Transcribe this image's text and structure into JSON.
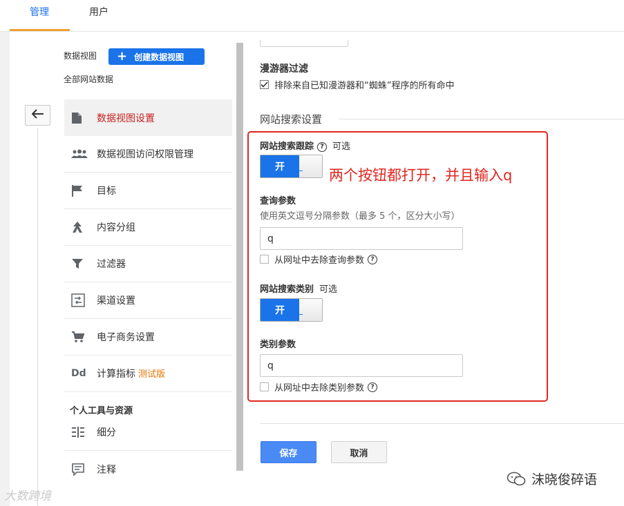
{
  "tabs": [
    {
      "label": "管理",
      "active": true
    },
    {
      "label": "用户",
      "active": false
    }
  ],
  "sidebar": {
    "view_label": "数据视图",
    "create_view_label": "创建数据视图",
    "all_data_label": "全部网站数据",
    "items": [
      {
        "label": "数据视图设置",
        "icon": "document-icon",
        "active": true
      },
      {
        "label": "数据视图访问权限管理",
        "icon": "users-icon"
      },
      {
        "label": "目标",
        "icon": "flag-icon"
      },
      {
        "label": "内容分组",
        "icon": "content-grouping-icon"
      },
      {
        "label": "过滤器",
        "icon": "filter-icon"
      },
      {
        "label": "渠道设置",
        "icon": "channel-settings-icon"
      },
      {
        "label": "电子商务设置",
        "icon": "cart-icon"
      },
      {
        "label": "计算指标",
        "icon": "dd-icon",
        "beta": "测试版"
      }
    ],
    "section_title": "个人工具与资源",
    "tool_items": [
      {
        "label": "细分",
        "icon": "segments-icon"
      },
      {
        "label": "注释",
        "icon": "annotation-icon"
      }
    ]
  },
  "main": {
    "bot_filter_title": "漫游器过滤",
    "bot_filter_checkbox": "排除来自已知漫游器和“蜘蛛”程序的所有命中",
    "bot_filter_checked": true,
    "site_search_section": "网站搜索设置",
    "tracking_label": "网站搜索跟踪",
    "optional_label": "可选",
    "toggle_on_label": "开",
    "annotation": "两个按钮都打开，并且输入q",
    "query_param_label": "查询参数",
    "query_param_hint": "使用英文逗号分隔参数（最多 5 个，区分大小写）",
    "query_param_value": "q",
    "strip_query_label": "从网址中去除查询参数",
    "category_label": "网站搜索类别",
    "category_optional": "可选",
    "category_param_label": "类别参数",
    "category_param_value": "q",
    "strip_category_label": "从网址中去除类别参数",
    "save_label": "保存",
    "cancel_label": "取消"
  },
  "watermark": {
    "left": "大数跨境",
    "right": "沫晓俊碎语"
  },
  "colors": {
    "accent_blue": "#1a73e8",
    "annotation_red": "#e0261e",
    "beta_orange": "#e37400"
  }
}
